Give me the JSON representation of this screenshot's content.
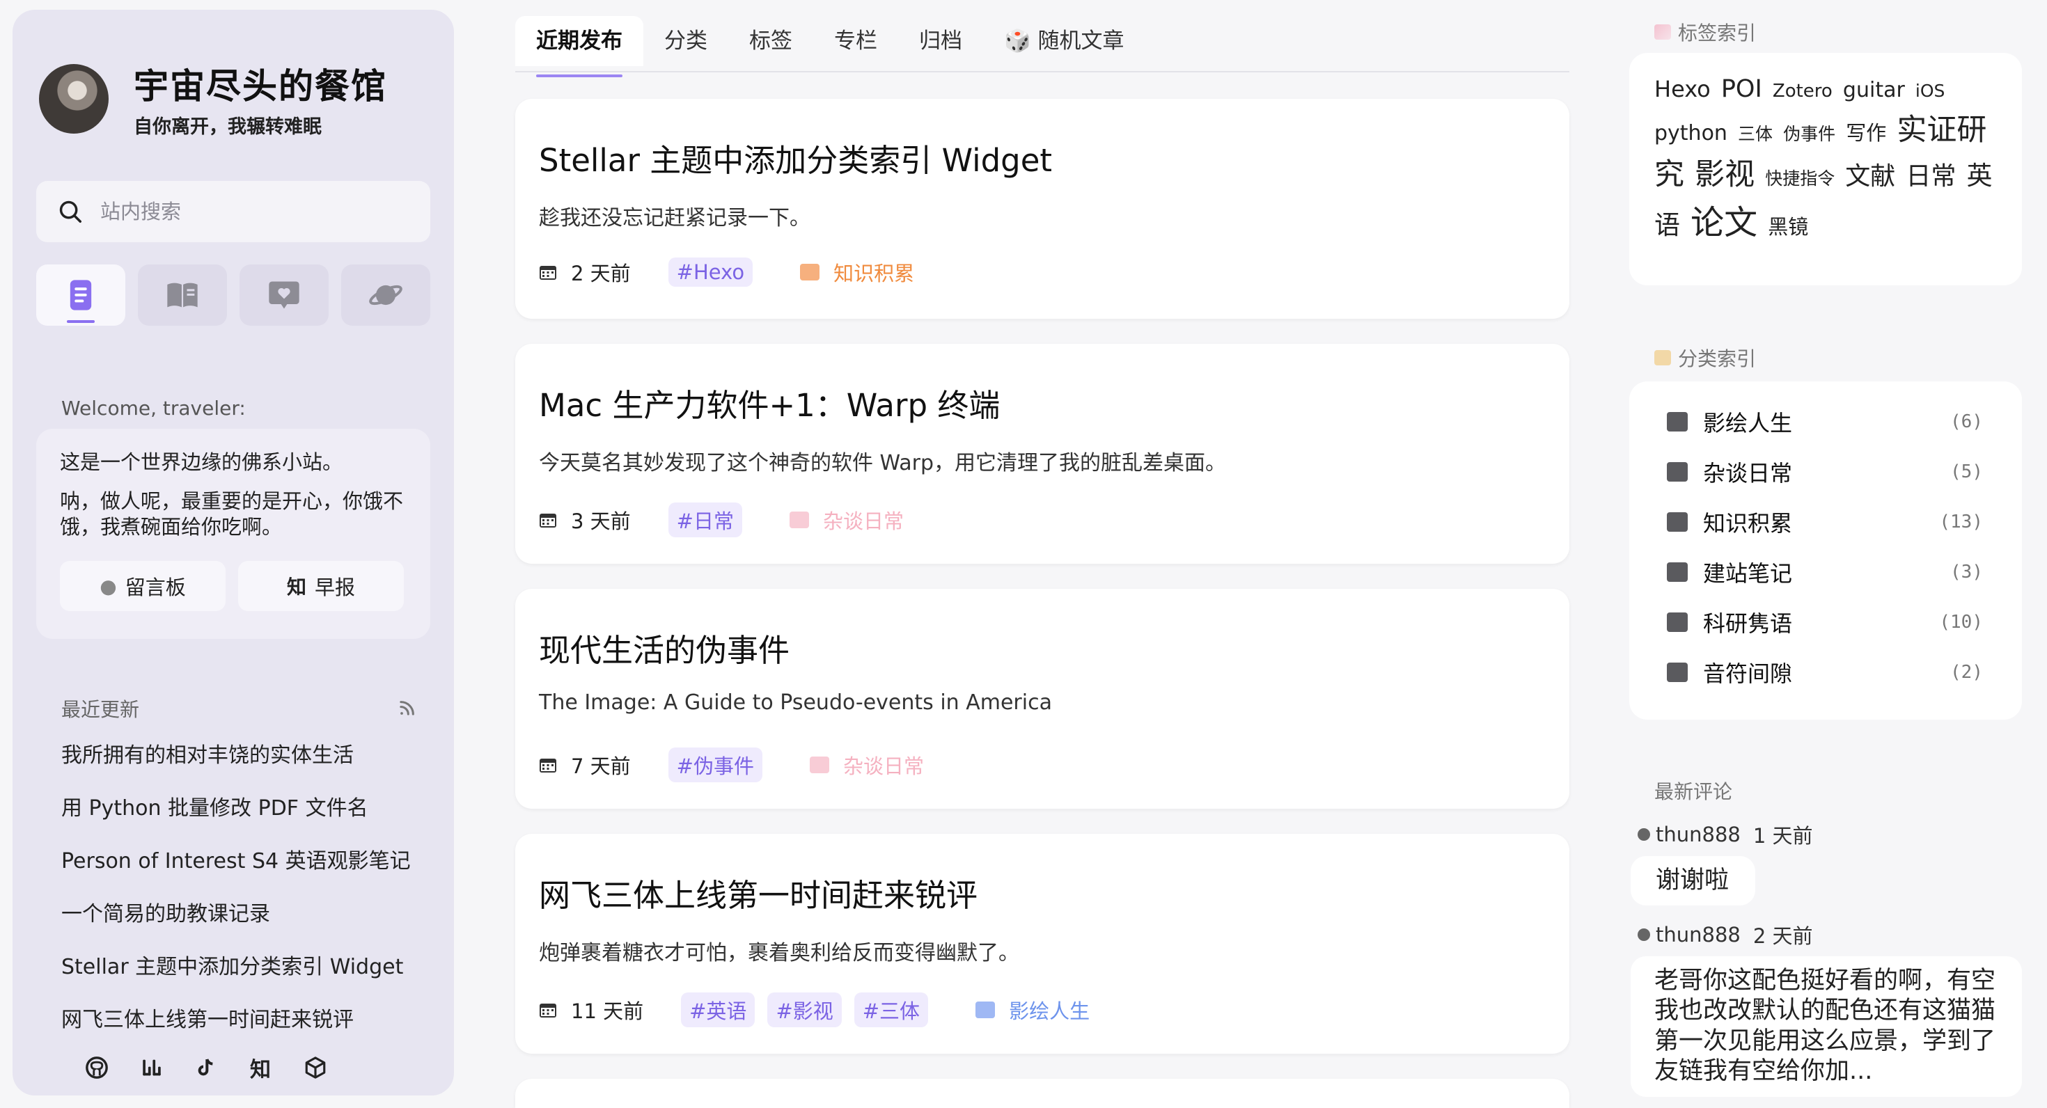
{
  "profile": {
    "title": "宇宙尽头的餐馆",
    "subtitle": "自你离开，我辗转难眠"
  },
  "search": {
    "placeholder": "站内搜索"
  },
  "welcome": {
    "label": "Welcome, traveler:",
    "line1": "这是一个世界边缘的佛系小站。",
    "line2": "呐，做人呢，最重要的是开心，你饿不饿，我煮碗面给你吃啊。",
    "btn_guestbook": "留言板",
    "btn_daily_icon": "知",
    "btn_daily": "早报"
  },
  "recent": {
    "title": "最近更新",
    "items": [
      "我所拥有的相对丰饶的实体生活",
      "用 Python 批量修改 PDF 文件名",
      "Person of Interest S4 英语观影笔记",
      "一个简易的助教课记录",
      "Stellar 主题中添加分类索引 Widget",
      "网飞三体上线第一时间赶来锐评"
    ]
  },
  "socials": {
    "zhihu": "知"
  },
  "tabs": [
    "近期发布",
    "分类",
    "标签",
    "专栏",
    "归档",
    "🎲 随机文章"
  ],
  "posts": [
    {
      "title": "Stellar 主题中添加分类索引 Widget",
      "excerpt": "趁我还没忘记赶紧记录一下。",
      "date": "2 天前",
      "tags": [
        "#Hexo"
      ],
      "category": "知识积累"
    },
    {
      "title": "Mac 生产力软件+1：Warp 终端",
      "excerpt": "今天莫名其妙发现了这个神奇的软件 Warp，用它清理了我的脏乱差桌面。",
      "date": "3 天前",
      "tags": [
        "#日常"
      ],
      "category": "杂谈日常"
    },
    {
      "title": "现代生活的伪事件",
      "excerpt": "The Image: A Guide to Pseudo-events in America",
      "date": "7 天前",
      "tags": [
        "#伪事件"
      ],
      "category": "杂谈日常"
    },
    {
      "title": "网飞三体上线第一时间赶来锐评",
      "excerpt": "炮弹裹着糖衣才可怕，裹着奥利给反而变得幽默了。",
      "date": "11 天前",
      "tags": [
        "#英语",
        "#影视",
        "#三体"
      ],
      "category": "影绘人生"
    }
  ],
  "tagcloud": {
    "title": "标签索引",
    "tags": [
      "Hexo",
      "POI",
      "Zotero",
      "guitar",
      "iOS",
      "python",
      "三体",
      "伪事件",
      "写作",
      "实证研究",
      "影视",
      "快捷指令",
      "文献",
      "日常",
      "英语",
      "论文",
      "黑镜"
    ]
  },
  "catindex": {
    "title": "分类索引",
    "items": [
      {
        "name": "影绘人生",
        "count": "(6)"
      },
      {
        "name": "杂谈日常",
        "count": "(5)"
      },
      {
        "name": "知识积累",
        "count": "(13)"
      },
      {
        "name": "建站笔记",
        "count": "(3)"
      },
      {
        "name": "科研隽语",
        "count": "(10)"
      },
      {
        "name": "音符间隙",
        "count": "(2)"
      }
    ]
  },
  "comments": {
    "title": "最新评论",
    "items": [
      {
        "user": "thun888",
        "time": "1 天前",
        "text": "谢谢啦"
      },
      {
        "user": "thun888",
        "time": "2 天前",
        "text": "老哥你这配色挺好看的啊，有空我也改改默认的配色还有这猫猫第一次见能用这么应景，学到了友链我有空给你加..."
      }
    ]
  },
  "colors": {
    "accent": "#8a6ff0",
    "tag_bg": "#efebfd",
    "tag_fg": "#7b63e4",
    "sidebar_bg": "#e7e5f1"
  },
  "icons": {
    "search": "search-icon",
    "rss": "rss-icon",
    "calendar": "calendar-icon",
    "folder": "folder-icon"
  }
}
